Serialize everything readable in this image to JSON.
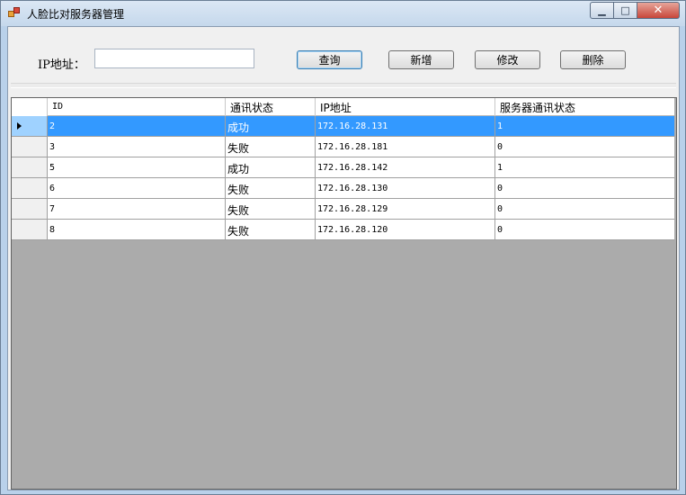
{
  "window": {
    "title": "人脸比对服务器管理"
  },
  "toolbar": {
    "ip_label": "IP地址：",
    "ip_value": "",
    "query_label": "查询",
    "add_label": "新增",
    "edit_label": "修改",
    "delete_label": "删除"
  },
  "grid": {
    "columns": [
      "ID",
      "通讯状态",
      "IP地址",
      "服务器通讯状态"
    ],
    "rows": [
      [
        "2",
        "成功",
        "172.16.28.131",
        "1"
      ],
      [
        "3",
        "失败",
        "172.16.28.181",
        "0"
      ],
      [
        "5",
        "成功",
        "172.16.28.142",
        "1"
      ],
      [
        "6",
        "失败",
        "172.16.28.130",
        "0"
      ],
      [
        "7",
        "失败",
        "172.16.28.129",
        "0"
      ],
      [
        "8",
        "失败",
        "172.16.28.120",
        "0"
      ]
    ],
    "selected_row": 0
  },
  "colors": {
    "selection": "#3399ff",
    "grid_background": "#ababab"
  }
}
